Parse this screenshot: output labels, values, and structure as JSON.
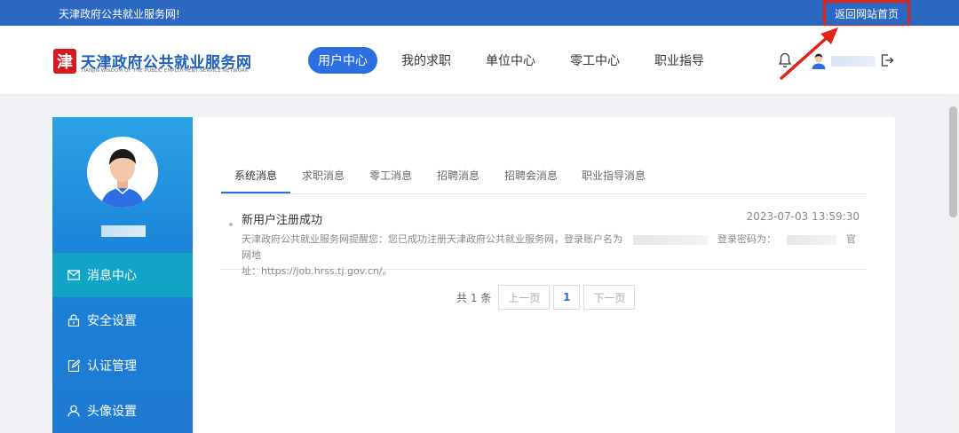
{
  "topbar": {
    "welcome": "天津政府公共就业服务网!",
    "home_link": "返回网站首页"
  },
  "brand": {
    "logo_char": "津",
    "title": "天津政府公共就业服务网",
    "subtitle": "TIANJIN WISDOM OF THE PUBLIC EMPLOYMENT SERVICE NETWORK"
  },
  "nav": {
    "items": [
      {
        "label": "用户中心",
        "active": true
      },
      {
        "label": "我的求职"
      },
      {
        "label": "单位中心"
      },
      {
        "label": "零工中心"
      },
      {
        "label": "职业指导"
      }
    ]
  },
  "header_icons": {
    "bell": "bell-icon",
    "avatar": "user-avatar-icon",
    "logout": "logout-icon"
  },
  "sidebar": {
    "items": [
      {
        "label": "消息中心",
        "icon": "mail-icon",
        "active": true
      },
      {
        "label": "安全设置",
        "icon": "lock-icon"
      },
      {
        "label": "认证管理",
        "icon": "edit-icon"
      },
      {
        "label": "头像设置",
        "icon": "user-icon"
      }
    ]
  },
  "tabs": [
    {
      "label": "系统消息",
      "active": true
    },
    {
      "label": "求职消息"
    },
    {
      "label": "零工消息"
    },
    {
      "label": "招聘消息"
    },
    {
      "label": "招聘会消息"
    },
    {
      "label": "职业指导消息"
    }
  ],
  "message": {
    "title": "新用户注册成功",
    "time": "2023-07-03 13:59:30",
    "body_part1": "天津政府公共就业服务网提醒您：您已成功注册天津政府公共就业服务网，登录账户名为",
    "body_part2": "登录密码为：",
    "body_part3": "官网地",
    "body_part4": "址：https://job.hrss.tj.gov.cn/。"
  },
  "pager": {
    "total": "共 1 条",
    "prev": "上一页",
    "page": "1",
    "next": "下一页"
  },
  "colors": {
    "topbar": "#2b68c2",
    "accent": "#2b6fe3",
    "sidebar_active": "#11a4c6",
    "highlight_box": "#e2231a"
  }
}
